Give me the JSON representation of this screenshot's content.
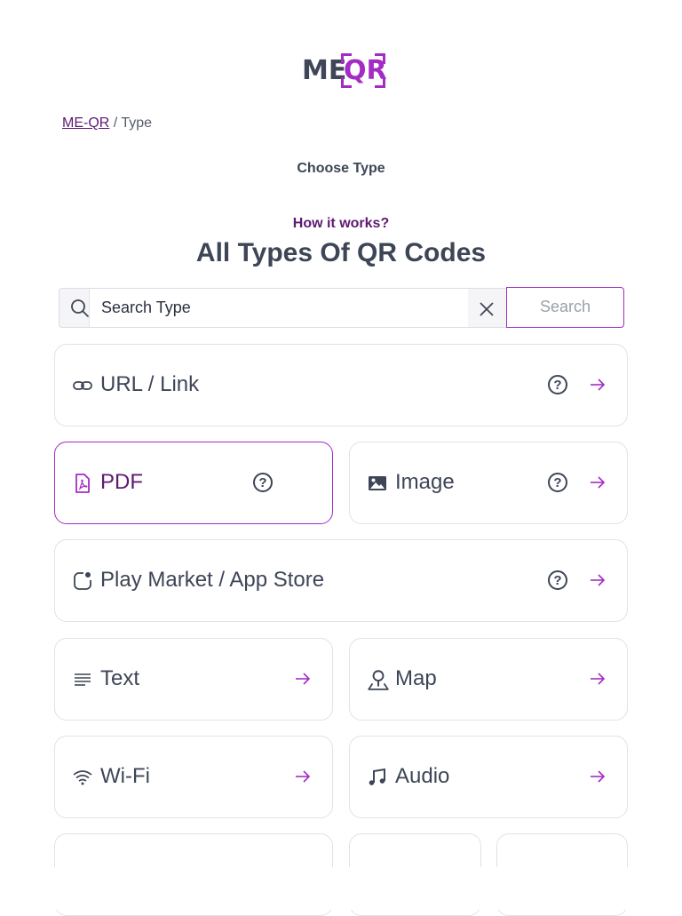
{
  "logo": {
    "left_text": "ME",
    "right_text": "QR",
    "brand_color": "#a42cc4",
    "dark_color": "#3f4658"
  },
  "breadcrumb": {
    "home": "ME-QR",
    "separator": " / ",
    "current": "Type"
  },
  "steps": {
    "current": "Choose Type"
  },
  "how_it_works": "How it works?",
  "page_title": "All Types Of QR Codes",
  "search": {
    "value": "Search Type",
    "placeholder": "Search Type",
    "button": "Search"
  },
  "types": {
    "url": {
      "label": "URL / Link",
      "icon": "link-icon"
    },
    "pdf": {
      "label": "PDF",
      "icon": "pdf-file-icon"
    },
    "image": {
      "label": "Image",
      "icon": "image-icon"
    },
    "app": {
      "label": "Play Market / App Store",
      "icon": "app-icon"
    },
    "text": {
      "label": "Text",
      "icon": "text-lines-icon"
    },
    "map": {
      "label": "Map",
      "icon": "map-pin-icon"
    },
    "wifi": {
      "label": "Wi-Fi",
      "icon": "wifi-icon"
    },
    "audio": {
      "label": "Audio",
      "icon": "music-note-icon"
    }
  },
  "help_glyph": "?",
  "colors": {
    "accent": "#a42cc4",
    "accent_dark": "#5e1a71",
    "text": "#3d4556",
    "border": "#dfe2e7"
  }
}
